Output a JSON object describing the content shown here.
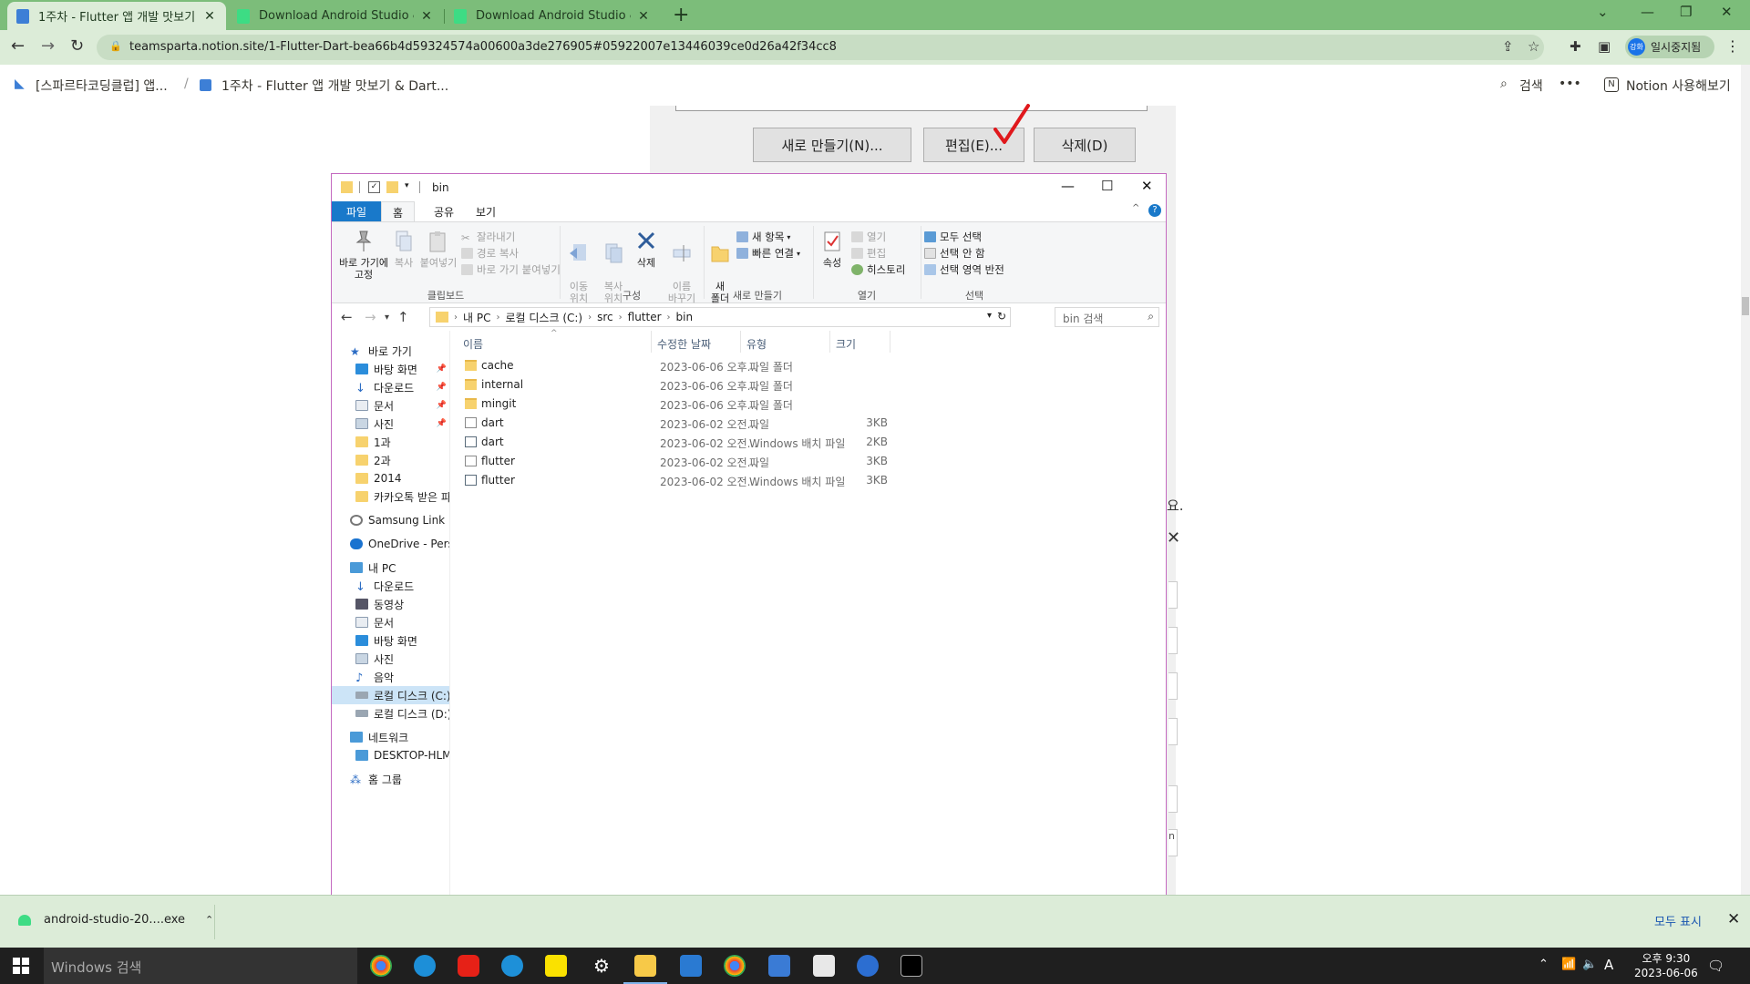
{
  "browser": {
    "tabs": [
      {
        "title": "1주차 - Flutter 앱 개발 맛보기 &",
        "active": true
      },
      {
        "title": "Download Android Studio & Ap",
        "active": false
      },
      {
        "title": "Download Android Studio & Ap",
        "active": false
      }
    ],
    "url": "teamsparta.notion.site/1-Flutter-Dart-bea66b4d59324574a00600a3de276905#05922007e13446039ce0d26a42f34cc8",
    "profile_label": "일시중지됨",
    "profile_avatar": "강화",
    "tab_color": "#7cbd7a"
  },
  "notion": {
    "breadcrumb_1": "[스파르타코딩클럽] 앱...",
    "breadcrumb_sep": "/",
    "breadcrumb_2": "1주차 - Flutter 앱 개발 맛보기 & Dart...",
    "search_label": "검색",
    "more_label": "•••",
    "try_notion_label": "Notion 사용해보기"
  },
  "embedded_dialog": {
    "new_btn": "새로 만들기(N)...",
    "edit_btn": "편집(E)...",
    "delete_btn": "삭제(D)",
    "frag_text": "요.",
    "frag_letter": "n"
  },
  "explorer": {
    "title": "bin",
    "ribbon_tabs": [
      "파일",
      "홈",
      "공유",
      "보기"
    ],
    "clipboard": {
      "pin": "바로 가기에\n고정",
      "copy": "복사",
      "paste": "붙여넣기",
      "cut": "잘라내기",
      "copy_path": "경로 복사",
      "paste_shortcut": "바로 가기 붙여넣기",
      "group": "클립보드"
    },
    "organize": {
      "move_to": "이동\n위치",
      "copy_to": "복사\n위치",
      "delete": "삭제",
      "rename": "이름\n바꾸기",
      "group": "구성"
    },
    "new": {
      "new_folder": "새\n폴더",
      "new_item": "새 항목",
      "easy_access": "빠른 연결",
      "group": "새로 만들기"
    },
    "open": {
      "properties": "속성",
      "open": "열기",
      "edit": "편집",
      "history": "히스토리",
      "group": "열기"
    },
    "select": {
      "select_all": "모두 선택",
      "select_none": "선택 안 함",
      "invert": "선택 영역 반전",
      "group": "선택"
    },
    "path": [
      "내 PC",
      "로컬 디스크 (C:)",
      "src",
      "flutter",
      "bin"
    ],
    "search_placeholder": "bin 검색",
    "columns": {
      "name": "이름",
      "date": "수정한 날짜",
      "type": "유형",
      "size": "크기"
    },
    "files": [
      {
        "name": "cache",
        "date": "2023-06-06 오후...",
        "type": "파일 폴더",
        "size": "",
        "kind": "folder"
      },
      {
        "name": "internal",
        "date": "2023-06-06 오후...",
        "type": "파일 폴더",
        "size": "",
        "kind": "folder"
      },
      {
        "name": "mingit",
        "date": "2023-06-06 오후...",
        "type": "파일 폴더",
        "size": "",
        "kind": "folder"
      },
      {
        "name": "dart",
        "date": "2023-06-02 오전...",
        "type": "파일",
        "size": "3KB",
        "kind": "doc"
      },
      {
        "name": "dart",
        "date": "2023-06-02 오전...",
        "type": "Windows 배치 파일",
        "size": "2KB",
        "kind": "bat"
      },
      {
        "name": "flutter",
        "date": "2023-06-02 오전...",
        "type": "파일",
        "size": "3KB",
        "kind": "doc"
      },
      {
        "name": "flutter",
        "date": "2023-06-02 오전...",
        "type": "Windows 배치 파일",
        "size": "3KB",
        "kind": "bat"
      }
    ],
    "nav": {
      "quick_access": "바로 가기",
      "desktop": "바탕 화면",
      "downloads": "다운로드",
      "documents": "문서",
      "pictures": "사진",
      "f1": "1과",
      "f2": "2과",
      "f3": "2014",
      "kakao": "카카오톡 받은 파일",
      "samsung_link": "Samsung Link",
      "onedrive": "OneDrive - Personal",
      "this_pc": "내 PC",
      "pc_downloads": "다운로드",
      "pc_videos": "동영상",
      "pc_documents": "문서",
      "pc_desktop": "바탕 화면",
      "pc_pictures": "사진",
      "pc_music": "음악",
      "drive_c": "로컬 디스크 (C:)",
      "drive_d": "로컬 디스크 (D:)",
      "network": "네트워크",
      "desktop_pc": "DESKTOP-HLMLTF",
      "homegroup": "홈 그룹"
    }
  },
  "downloads": {
    "item": "android-studio-20....exe",
    "show_all": "모두 표시"
  },
  "taskbar": {
    "search_placeholder": "Windows 검색",
    "ime": "A",
    "time": "오후 9:30",
    "date": "2023-06-06"
  }
}
